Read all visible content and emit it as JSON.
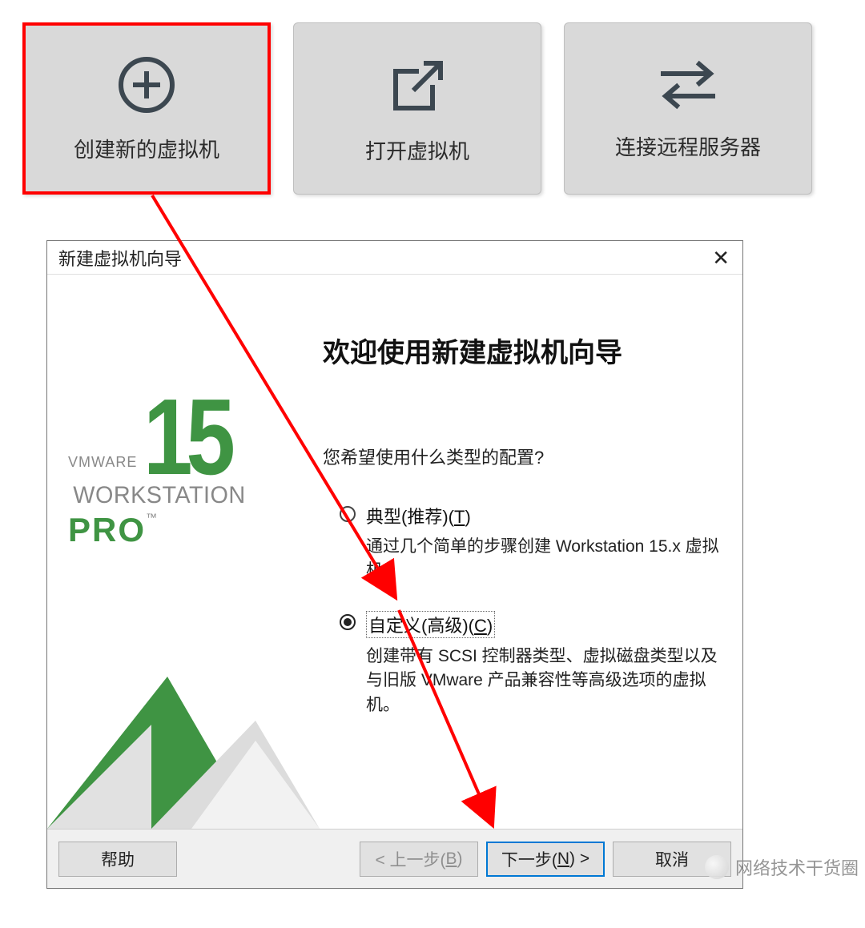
{
  "tiles": [
    {
      "label": "创建新的虚拟机",
      "selected": true,
      "icon": "plus-circle"
    },
    {
      "label": "打开虚拟机",
      "selected": false,
      "icon": "open-external"
    },
    {
      "label": "连接远程服务器",
      "selected": false,
      "icon": "swap-arrows"
    }
  ],
  "dialog": {
    "title": "新建虚拟机向导",
    "heading": "欢迎使用新建虚拟机向导",
    "prompt": "您希望使用什么类型的配置?",
    "options": [
      {
        "title_pre": "典型(推荐)(",
        "title_key": "T",
        "title_post": ")",
        "desc": "通过几个简单的步骤创建 Workstation 15.x 虚拟机。",
        "selected": false
      },
      {
        "title_pre": "自定义(高级)(",
        "title_key": "C",
        "title_post": ")",
        "desc": "创建带有 SCSI 控制器类型、虚拟磁盘类型以及与旧版 VMware 产品兼容性等高级选项的虚拟机。",
        "selected": true
      }
    ],
    "buttons": {
      "help": "帮助",
      "back_pre": "< 上一步(",
      "back_key": "B",
      "back_post": ")",
      "next_pre": "下一步(",
      "next_key": "N",
      "next_post": ") >",
      "cancel": "取消"
    },
    "brand": {
      "vmware": "VMWARE",
      "version": "15",
      "workstation": "WORKSTATION",
      "pro": "PRO",
      "tm": "™"
    }
  },
  "watermark": "网络技术干货圈"
}
